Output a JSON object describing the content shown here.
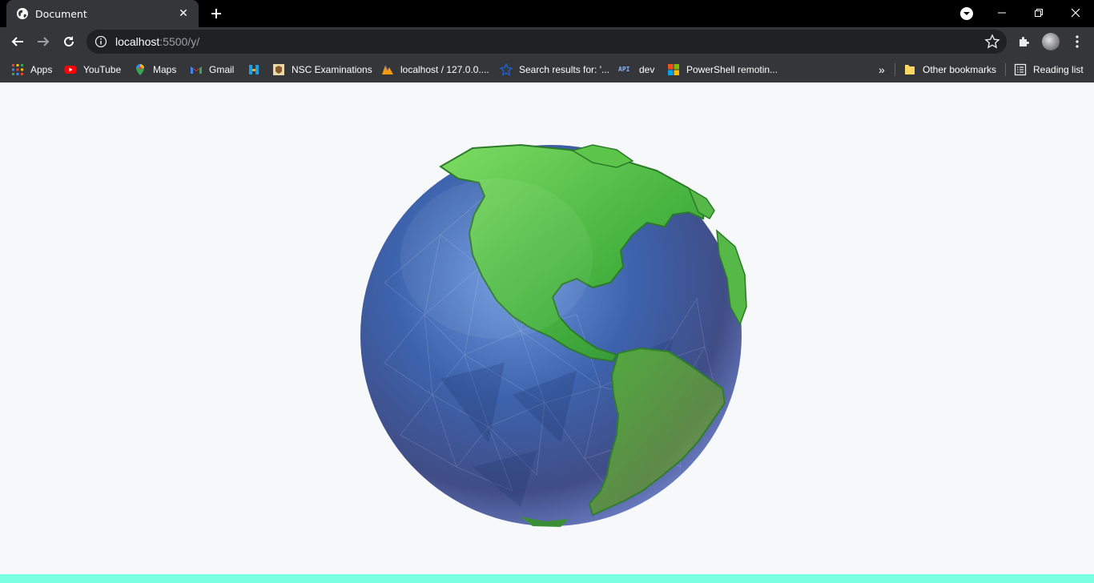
{
  "tab": {
    "title": "Document",
    "close": "✕"
  },
  "toolbar": {
    "url_host": "localhost",
    "url_path": ":5500/y/"
  },
  "bookmarks": {
    "items": [
      {
        "label": "Apps",
        "icon": "apps-grid-icon"
      },
      {
        "label": "YouTube",
        "icon": "youtube-icon"
      },
      {
        "label": "Maps",
        "icon": "maps-pin-icon"
      },
      {
        "label": "Gmail",
        "icon": "gmail-icon"
      },
      {
        "label": "",
        "icon": "hackerrank-like-icon"
      },
      {
        "label": "NSC Examinations",
        "icon": "nsc-crest-icon"
      },
      {
        "label": "localhost / 127.0.0....",
        "icon": "phpmyadmin-icon"
      },
      {
        "label": "Search results for: '...",
        "icon": "star-blue-icon"
      },
      {
        "label": "dev",
        "icon": "api-icon"
      },
      {
        "label": "PowerShell remotin...",
        "icon": "microsoft-icon"
      }
    ],
    "overflow": "»",
    "other": "Other bookmarks",
    "reading_list": "Reading list"
  },
  "colors": {
    "tabstrip": "#000000",
    "toolbar": "#35363a",
    "omnibox": "#202124",
    "content_bg": "#f7f8fa",
    "bottom_strip": "#79ffe2",
    "ocean": "#4a6fb5",
    "land": "#4fb84a"
  }
}
